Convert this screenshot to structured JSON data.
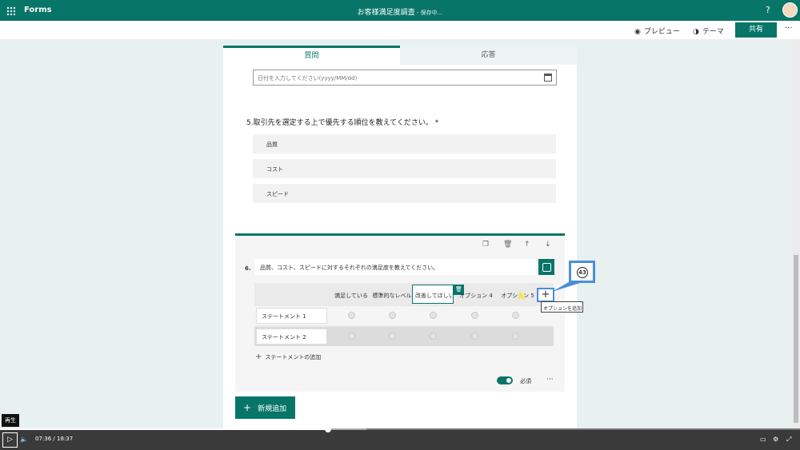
{
  "topbar": {
    "app_name": "Forms",
    "title": "お客様満足度調査",
    "saving": " - 保存中...",
    "help": "?"
  },
  "toolbar": {
    "preview": "プレビュー",
    "theme": "テーマ",
    "share": "共有",
    "more": "···"
  },
  "tabs": {
    "questions": "質問",
    "responses": "応答"
  },
  "date_question": {
    "placeholder": "日付を入力してください(yyyy/MM/dd)"
  },
  "q5": {
    "title": "5.取引先を選定する上で優先する順位を教えてください。 *",
    "items": [
      "品質",
      "コスト",
      "スピード"
    ]
  },
  "q6": {
    "number": "6.",
    "text": "品質、コスト、スピードに対するそれぞれの満足度を教えてください。",
    "columns": [
      "満足している",
      "標準的なレベル",
      "改善してほしい",
      "オプション 4",
      "オプション 5"
    ],
    "rows": [
      "ステートメント 1",
      "ステートメント 2"
    ],
    "add_statement": "ステートメントの追加",
    "required_label": "必須",
    "more": "···"
  },
  "new_button": "新規追加",
  "tooltip": "オプションを追加",
  "callout_number": "43",
  "player": {
    "tooltip": "再生",
    "current": "07:36",
    "separator": " / ",
    "total": "18:37",
    "progress": 0.41
  },
  "colors": {
    "accent": "#077568",
    "callout": "#4a8ed8"
  }
}
